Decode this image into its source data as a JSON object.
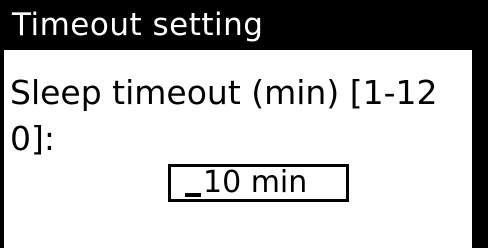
{
  "window": {
    "title": "Timeout setting"
  },
  "form": {
    "prompt": "Sleep timeout (min) [1-120]:",
    "input_value": "10 min"
  },
  "colors": {
    "background": "#ffffff",
    "foreground": "#000000",
    "title_text": "#ffffff"
  }
}
